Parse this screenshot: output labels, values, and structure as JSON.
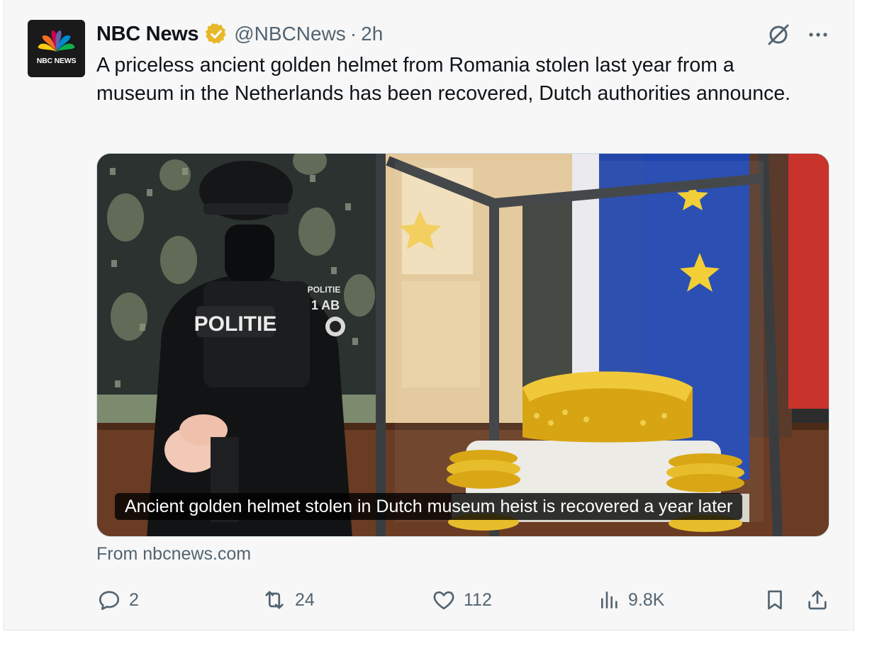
{
  "account": {
    "display_name": "NBC News",
    "handle": "@NBCNews",
    "separator": "·",
    "time": "2h",
    "avatar_text": "NBC NEWS"
  },
  "tweet": {
    "text": "A priceless ancient golden helmet from Romania stolen last year from a museum in the Netherlands has been recovered, Dutch authorities announce."
  },
  "card": {
    "caption": "Ancient golden helmet stolen in Dutch museum heist is recovered a year later",
    "source": "From nbcnews.com",
    "vest_text": "POLITIE",
    "patch_line1": "POLITIE",
    "patch_line2": "1 AB"
  },
  "actions": {
    "replies": "2",
    "reposts": "24",
    "likes": "112",
    "views": "9.8K"
  },
  "colors": {
    "verified": "#e8b829",
    "muted": "#536471",
    "text": "#0f1419"
  },
  "icons": [
    "nbc-peacock-icon",
    "verified-badge-icon",
    "grok-icon",
    "more-icon",
    "reply-icon",
    "repost-icon",
    "like-icon",
    "views-icon",
    "bookmark-icon",
    "share-icon"
  ]
}
